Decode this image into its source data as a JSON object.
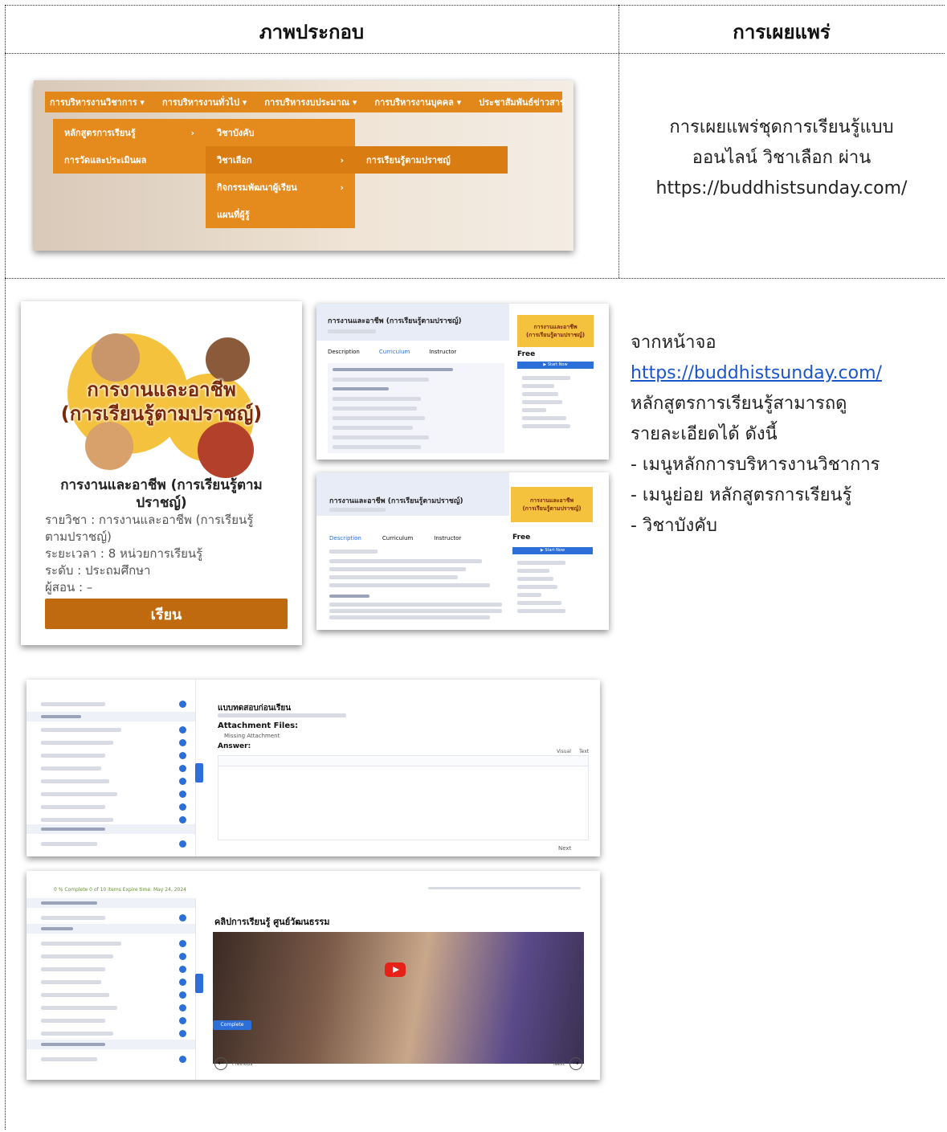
{
  "table": {
    "header_illustration": "ภาพประกอบ",
    "header_publication": "การเผยแพร่",
    "row1_description": [
      "การเผยแพร่ชุดการเรียนรู้แบบ",
      "ออนไลน์ วิชาเลือก ผ่าน",
      "https://buddhistsunday.com/"
    ],
    "row2_intro": "จากหน้าจอ",
    "row2_link": "https://buddhistsunday.com/",
    "row2_lines": [
      "หลักสูตรการเรียนรู้สามารถดู",
      "รายละเอียดได้ ดังนี้",
      "- เมนูหลักการบริหารงานวิชาการ",
      "- เมนูย่อย หลักสูตรการเรียนรู้",
      "- วิชาบังคับ"
    ]
  },
  "menu_screenshot": {
    "top_items": [
      "การบริหารงานวิชาการ ▾",
      "การบริหารงานทั่วไป ▾",
      "การบริหารงบประมาณ ▾",
      "การบริหารงานบุคคล ▾",
      "ประชาสัมพันธ์ข่าวสาร"
    ],
    "col1": [
      "หลักสูตรการเรียนรู้",
      "การวัดและประเมินผล"
    ],
    "col2": [
      "วิชาบังคับ",
      "วิชาเลือก",
      "กิจกรรมพัฒนาผู้เรียน",
      "แผนที่ผู้รู้"
    ],
    "col3": [
      "การเรียนรู้ตามปราชญ์"
    ],
    "arrow": "›"
  },
  "course_card": {
    "poster_title_1": "การงานและอาชีพ",
    "poster_title_2": "(การเรียนรู้ตามปราชญ์)",
    "title_1": "การงานและอาชีพ (การเรียนรู้ตาม",
    "title_2": "ปราชญ์)",
    "rows": [
      "รายวิชา   : การงานและอาชีพ (การเรียนรู้",
      "ตามปราชญ์)",
      "ระยะเวลา : 8 หน่วยการเรียนรู้",
      "ระดับ      : ประถมศึกษา",
      "ผู้สอน     : –"
    ],
    "button": "เรียน"
  },
  "course_page": {
    "title": "การงานและอาชีพ (การเรียนรู้ตามปราชญ์)",
    "tabs": [
      "Description",
      "Curriculum",
      "Instructor"
    ],
    "price": "Free",
    "start": "▶ Start Now",
    "thumb_1": "การงานและอาชีพ",
    "thumb_2": "(การเรียนรู้ตามปราชญ์)"
  },
  "lesson_page": {
    "heading": "แบบทดสอบก่อนเรียน",
    "attachment": "Attachment Files:",
    "missing": "Missing Attachment",
    "answer": "Answer:",
    "visual": "Visual",
    "text": "Text",
    "next": "Next"
  },
  "video_page": {
    "progress": "0 % Complete   0 of 10 items   Expire time: May 24, 2024",
    "heading": "คลิปการเรียนรู้ ศูนย์วัฒนธรรม",
    "complete": "Complete",
    "previous": "Previous",
    "next": "Next"
  },
  "colors": {
    "menu_orange": "#e58a1d",
    "button_brown": "#bf6a0f",
    "link_blue": "#1a55c9",
    "accent_blue": "#2d6fd8"
  }
}
